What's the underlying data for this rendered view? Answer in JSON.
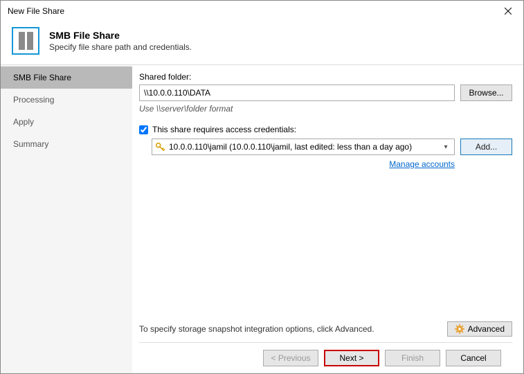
{
  "window": {
    "title": "New File Share"
  },
  "header": {
    "title": "SMB File Share",
    "subtitle": "Specify file share path and credentials."
  },
  "sidebar": {
    "items": [
      {
        "label": "SMB File Share"
      },
      {
        "label": "Processing"
      },
      {
        "label": "Apply"
      },
      {
        "label": "Summary"
      }
    ]
  },
  "content": {
    "sharedFolderLabel": "Shared folder:",
    "sharedFolderValue": "\\\\10.0.0.110\\DATA",
    "browseLabel": "Browse...",
    "formatHint": "Use \\\\server\\folder format",
    "credCheckboxLabel": "This share requires access credentials:",
    "credSelected": "10.0.0.110\\jamil (10.0.0.110\\jamil, last edited: less than a day ago)",
    "addLabel": "Add...",
    "manageAccounts": "Manage accounts",
    "advancedHint": "To specify storage snapshot integration options, click Advanced.",
    "advancedLabel": "Advanced"
  },
  "footer": {
    "previous": "< Previous",
    "next": "Next >",
    "finish": "Finish",
    "cancel": "Cancel"
  }
}
